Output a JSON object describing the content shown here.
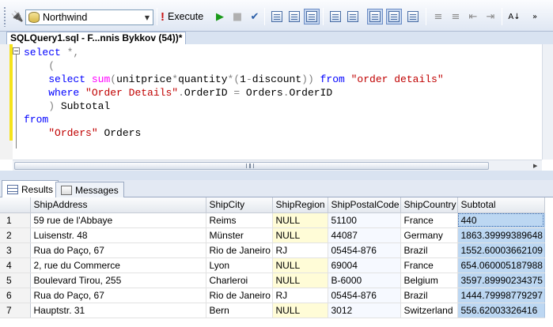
{
  "toolbar": {
    "database": "Northwind",
    "execute_label": "Execute"
  },
  "document_tab": {
    "title": "SQLQuery1.sql - F...nnis Bykkov (54))*"
  },
  "editor": {
    "lines": [
      {
        "tokens": [
          [
            "kw",
            "select"
          ],
          [
            "gray",
            " *,"
          ]
        ]
      },
      {
        "tokens": [
          [
            "gray",
            "    ("
          ]
        ]
      },
      {
        "tokens": [
          [
            "plain",
            "    "
          ],
          [
            "kw",
            "select"
          ],
          [
            "plain",
            " "
          ],
          [
            "fn",
            "sum"
          ],
          [
            "gray",
            "("
          ],
          [
            "plain",
            "unitprice"
          ],
          [
            "gray",
            "*"
          ],
          [
            "plain",
            "quantity"
          ],
          [
            "gray",
            "*("
          ],
          [
            "plain",
            "1"
          ],
          [
            "gray",
            "-"
          ],
          [
            "plain",
            "discount"
          ],
          [
            "gray",
            "))"
          ],
          [
            "plain",
            " "
          ],
          [
            "kw",
            "from"
          ],
          [
            "plain",
            " "
          ],
          [
            "red",
            "\"order details\""
          ]
        ]
      },
      {
        "tokens": [
          [
            "plain",
            "    "
          ],
          [
            "kw",
            "where"
          ],
          [
            "plain",
            " "
          ],
          [
            "red",
            "\"Order Details\""
          ],
          [
            "gray",
            "."
          ],
          [
            "plain",
            "OrderID "
          ],
          [
            "gray",
            "="
          ],
          [
            "plain",
            " Orders"
          ],
          [
            "gray",
            "."
          ],
          [
            "plain",
            "OrderID"
          ]
        ]
      },
      {
        "tokens": [
          [
            "gray",
            "    )"
          ],
          [
            "plain",
            " Subtotal"
          ]
        ]
      },
      {
        "tokens": [
          [
            "kw",
            "from"
          ]
        ]
      },
      {
        "tokens": [
          [
            "plain",
            "    "
          ],
          [
            "red",
            "\"Orders\""
          ],
          [
            "plain",
            " Orders"
          ]
        ]
      }
    ]
  },
  "results_tabs": {
    "results_label": "Results",
    "messages_label": "Messages"
  },
  "grid": {
    "columns": [
      "ShipAddress",
      "ShipCity",
      "ShipRegion",
      "ShipPostalCode",
      "ShipCountry",
      "Subtotal"
    ],
    "rows": [
      {
        "num": "1",
        "cells": [
          "59 rue de l'Abbaye",
          "Reims",
          "NULL",
          "51100",
          "France",
          "440"
        ]
      },
      {
        "num": "2",
        "cells": [
          "Luisenstr. 48",
          "Münster",
          "NULL",
          "44087",
          "Germany",
          "1863.39999389648"
        ]
      },
      {
        "num": "3",
        "cells": [
          "Rua do Paço, 67",
          "Rio de Janeiro",
          "RJ",
          "05454-876",
          "Brazil",
          "1552.60003662109"
        ]
      },
      {
        "num": "4",
        "cells": [
          "2, rue du Commerce",
          "Lyon",
          "NULL",
          "69004",
          "France",
          "654.060005187988"
        ]
      },
      {
        "num": "5",
        "cells": [
          "Boulevard Tirou, 255",
          "Charleroi",
          "NULL",
          "B-6000",
          "Belgium",
          "3597.89990234375"
        ]
      },
      {
        "num": "6",
        "cells": [
          "Rua do Paço, 67",
          "Rio de Janeiro",
          "RJ",
          "05454-876",
          "Brazil",
          "1444.79998779297"
        ]
      },
      {
        "num": "7",
        "cells": [
          "Hauptstr. 31",
          "Bern",
          "NULL",
          "3012",
          "Switzerland",
          "556.62003326416"
        ]
      }
    ]
  }
}
